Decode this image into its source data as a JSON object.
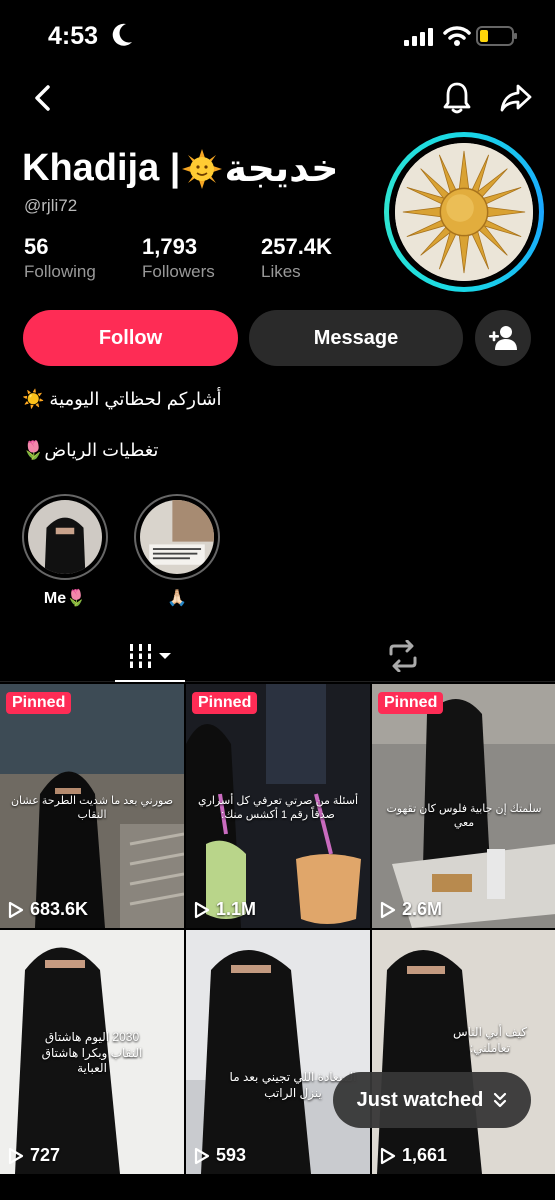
{
  "status": {
    "time": "4:53"
  },
  "profile": {
    "name_latin": "Khadija |",
    "name_arabic": "خديجة",
    "handle": "@rjli72",
    "following_count": "56",
    "following_label": "Following",
    "followers_count": "1,793",
    "followers_label": "Followers",
    "likes_count": "257.4K",
    "likes_label": "Likes"
  },
  "actions": {
    "follow_label": "Follow",
    "message_label": "Message"
  },
  "bio": {
    "line1": "أشاركم لحظاتي اليومية ☀️",
    "line2": "تغطيات الرياض🌷"
  },
  "highlights": [
    {
      "label": "Me🌷"
    },
    {
      "label": "🙏🏻"
    }
  ],
  "videos": [
    {
      "pinned": "Pinned",
      "views": "683.6K",
      "caption": "صورني بعد ما شديت الطرحة عشان النقاب"
    },
    {
      "pinned": "Pinned",
      "views": "1.1M",
      "caption": "أسئلة من صرتي تعرفي كل أسراري صدقاً رقم 1 أكشس منك:"
    },
    {
      "pinned": "Pinned",
      "views": "2.6M",
      "caption": "سلمتك إن جابية فلوس كان تقهوت معي"
    },
    {
      "pinned": "",
      "views": "727",
      "caption": "2030 اليوم هاشتاق النقاب وبكرا هاشتاق العباية"
    },
    {
      "pinned": "",
      "views": "593",
      "caption": "السعادة اللي تجيني بعد ما ينزل الراتب"
    },
    {
      "pinned": "",
      "views": "1,661",
      "caption": "كيف أبي الناس تعاملني:"
    }
  ],
  "just_watched_label": "Just watched",
  "colors": {
    "accent": "#fe2c55",
    "ring": "#19d8e6"
  }
}
